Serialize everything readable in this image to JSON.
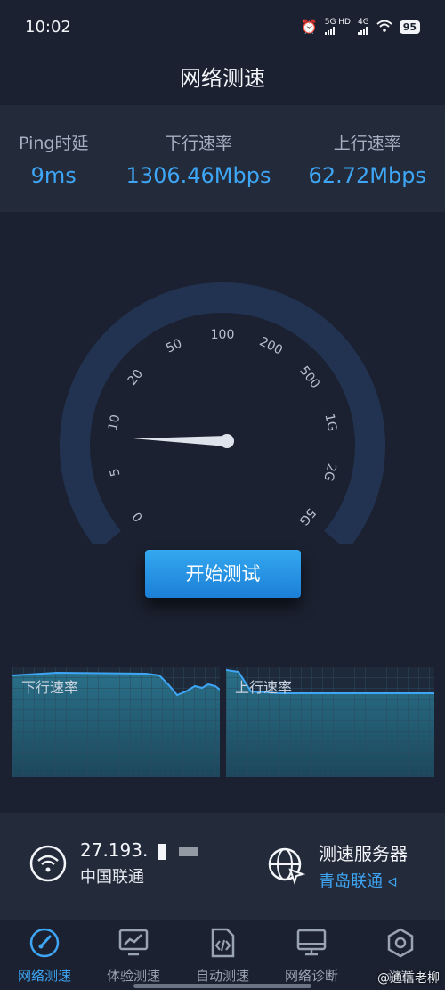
{
  "status_bar": {
    "time": "10:02",
    "signal1_label": "5G HD",
    "signal2_label": "4G",
    "battery": "95"
  },
  "header": {
    "title": "网络测速"
  },
  "metrics": {
    "ping": {
      "label": "Ping时延",
      "value": "9ms"
    },
    "download": {
      "label": "下行速率",
      "value": "1306.46Mbps"
    },
    "upload": {
      "label": "上行速率",
      "value": "62.72Mbps"
    }
  },
  "gauge": {
    "ticks": [
      "0",
      "5",
      "10",
      "20",
      "50",
      "100",
      "200",
      "500",
      "1G",
      "2G",
      "5G"
    ],
    "needle_value_fraction": 0.16
  },
  "start_button": {
    "label": "开始测试"
  },
  "charts": {
    "download_label": "下行速率",
    "upload_label": "上行速率",
    "line_color": "#3ea6f5"
  },
  "info": {
    "ip": "27.193.",
    "isp": "中国联通",
    "server_title": "测速服务器",
    "server_name": "青岛联通"
  },
  "tabs": [
    {
      "label": "网络测速",
      "icon": "speedometer-icon",
      "active": true
    },
    {
      "label": "体验测速",
      "icon": "monitor-chart-icon",
      "active": false
    },
    {
      "label": "自动测速",
      "icon": "code-doc-icon",
      "active": false
    },
    {
      "label": "网络诊断",
      "icon": "desktop-icon",
      "active": false
    },
    {
      "label": "设置",
      "icon": "hexagon-gear-icon",
      "active": false
    }
  ],
  "watermark": "@通信老柳",
  "colors": {
    "accent": "#3ea6f5",
    "background": "#1b2130",
    "panel": "#232a3a"
  }
}
